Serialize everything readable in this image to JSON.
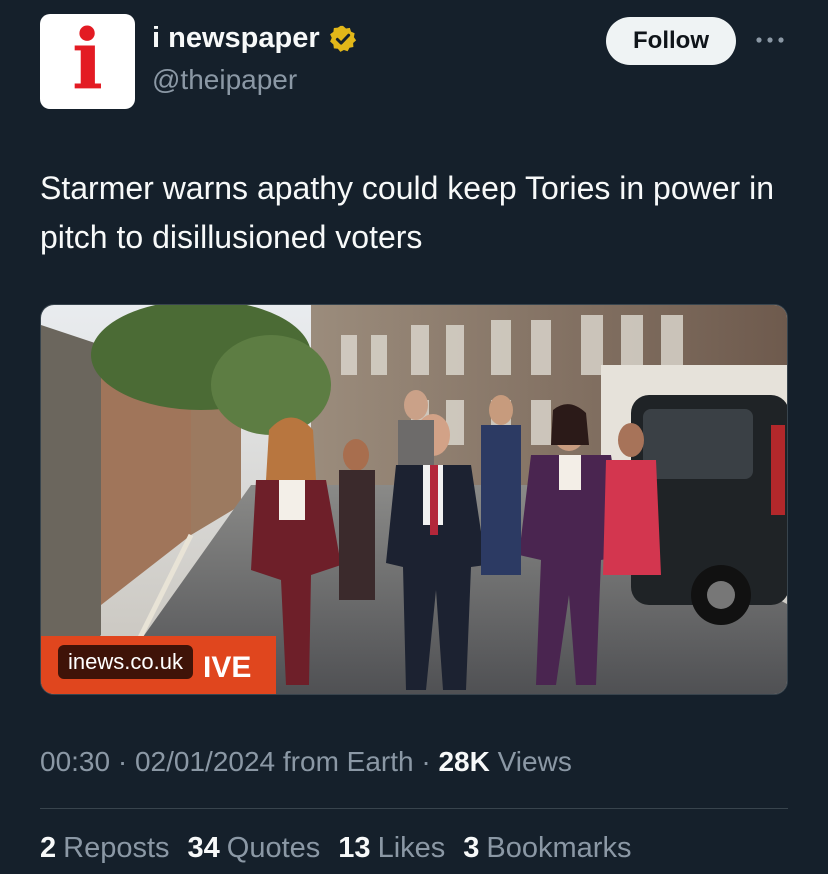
{
  "account": {
    "logo_letter": "i",
    "display_name": "i newspaper",
    "handle": "@theipaper",
    "verified_badge_icon": "gold-verified-badge",
    "verified_color": "#e2b719"
  },
  "header": {
    "follow_label": "Follow",
    "more_icon": "more-horizontal-icon"
  },
  "tweet": {
    "text": "Starmer warns apathy could keep Tories in power in pitch to disillusioned voters"
  },
  "media": {
    "banner_text": "EXCLUSIVE",
    "banner_visible_text": "IVE",
    "banner_color": "#e0461e",
    "link_domain": "inews.co.uk"
  },
  "meta": {
    "time": "00:30",
    "separator": "·",
    "date": "02/01/2024",
    "source": "from Earth",
    "views_count": "28K",
    "views_label": "Views"
  },
  "stats": [
    {
      "count": "2",
      "label": "Reposts"
    },
    {
      "count": "34",
      "label": "Quotes"
    },
    {
      "count": "13",
      "label": "Likes"
    },
    {
      "count": "3",
      "label": "Bookmarks"
    }
  ],
  "colors": {
    "background": "#15202b",
    "text_primary": "#f7f9f9",
    "text_secondary": "#8b98a5",
    "divider": "#38444d",
    "logo_red": "#e31b23"
  }
}
